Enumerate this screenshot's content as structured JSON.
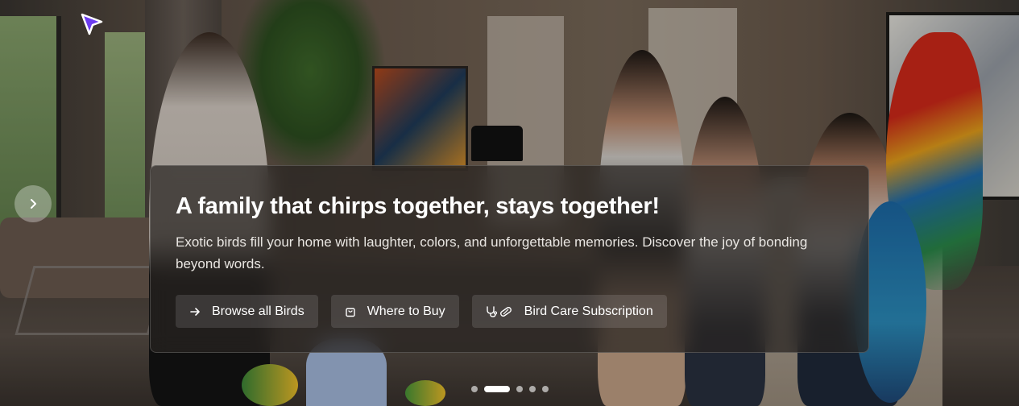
{
  "hero": {
    "title": "A family that chirps together, stays together!",
    "description": "Exotic birds fill your home with laughter, colors, and unforgettable memories. Discover the joy of bonding beyond words.",
    "buttons": [
      {
        "label": "Browse all Birds",
        "icon": "arrow-right-icon"
      },
      {
        "label": "Where to Buy",
        "icon": "shopping-bag-icon"
      },
      {
        "label": "Bird Care Subscription",
        "icon": "stethoscope-pill-icon"
      }
    ]
  },
  "carousel": {
    "slide_count": 5,
    "active_index": 1,
    "next_icon": "chevron-right-icon"
  },
  "colors": {
    "card_bg": "#282421",
    "text": "#ffffff",
    "cursor": "#6c3cf0"
  }
}
